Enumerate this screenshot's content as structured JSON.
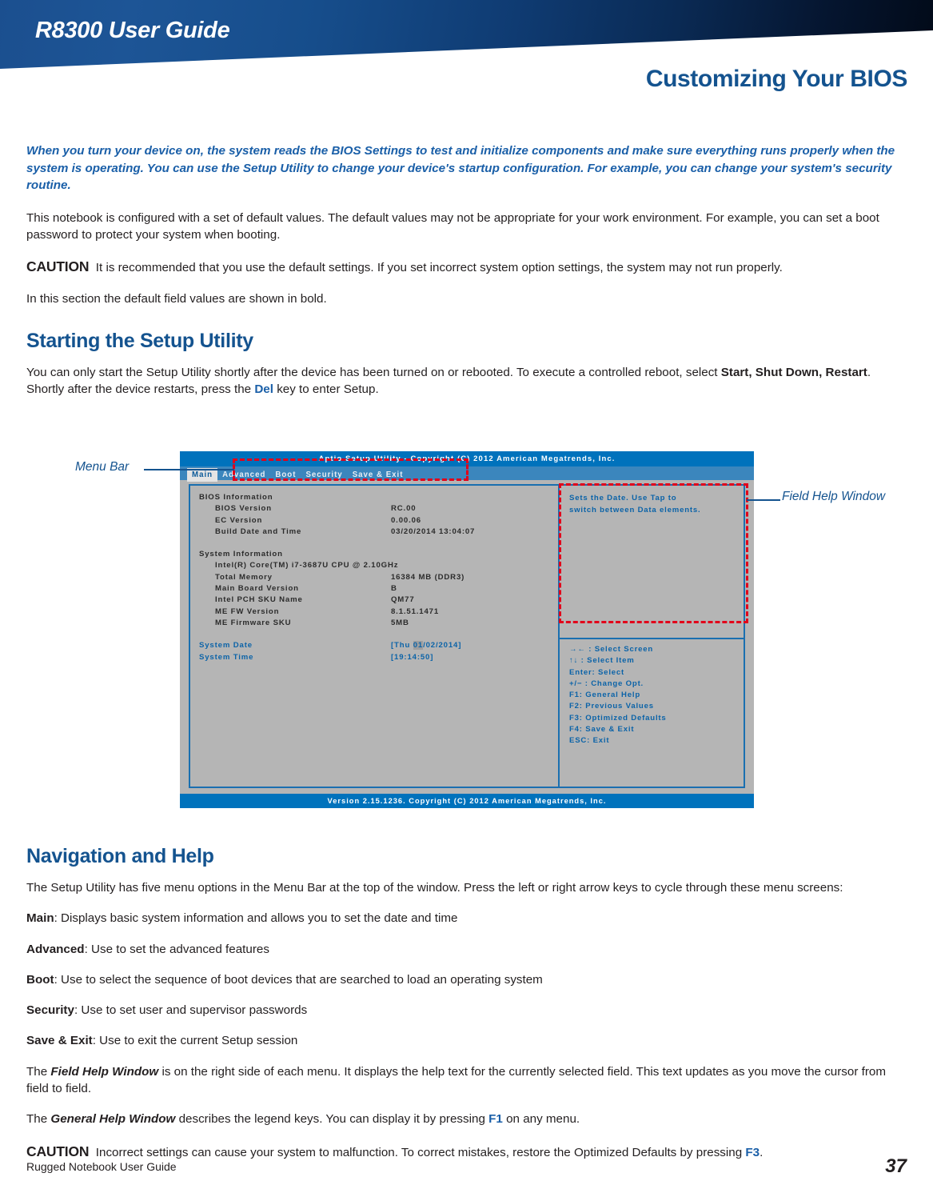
{
  "header": {
    "product_title": "R8300 User Guide",
    "chapter_title": "Customizing Your BIOS"
  },
  "intro": {
    "lead": "When you turn your device on, the system reads the BIOS Settings to test and initialize components and make sure everything runs properly when the system is operating. You can use the Setup Utility to change your device's startup configuration. For example, you can change your system's security routine.",
    "paragraph1": "This notebook is configured with a set of default values. The default values may not be appropriate for your work environment. For example, you can set a boot password to protect your system when booting.",
    "caution_label": "CAUTION",
    "caution1": "It is recommended that you use the default settings. If you set incorrect system option settings, the system may not run properly.",
    "paragraph2": "In this section the default field values are shown in bold."
  },
  "starting": {
    "heading": "Starting the Setup Utility",
    "body_part1": "You can only start the Setup Utility shortly after the device has been turned on or rebooted. To execute a controlled reboot, select ",
    "body_bold": "Start, Shut Down, Restart",
    "body_part2": ". Shortly after the device restarts, press the ",
    "body_key": "Del",
    "body_part3": " key to enter Setup."
  },
  "figure": {
    "callout_menu_bar": "Menu Bar",
    "callout_field_help": "Field Help Window",
    "bios": {
      "titlebar": "Aptio Setup Utility - Copyright (C) 2012 American Megatrends, Inc.",
      "menu_items": [
        {
          "label": "Main",
          "active": true
        },
        {
          "label": "Advanced",
          "active": false
        },
        {
          "label": "Boot",
          "active": false
        },
        {
          "label": "Security",
          "active": false
        },
        {
          "label": "Save & Exit",
          "active": false
        }
      ],
      "bios_info_heading": "BIOS Information",
      "bios_info_rows": [
        {
          "label": "BIOS Version",
          "value": "RC.00"
        },
        {
          "label": "EC Version",
          "value": "0.00.06"
        },
        {
          "label": "Build Date and Time",
          "value": "03/20/2014 13:04:07"
        }
      ],
      "system_info_heading": "System Information",
      "cpu_line": "Intel(R) Core(TM) i7-3687U CPU @ 2.10GHz",
      "system_info_rows": [
        {
          "label": "Total Memory",
          "value": "16384 MB (DDR3)"
        },
        {
          "label": "Main Board  Version",
          "value": "B"
        },
        {
          "label": "Intel PCH SKU Name",
          "value": "QM77"
        },
        {
          "label": "ME FW Version",
          "value": "8.1.51.1471"
        },
        {
          "label": "ME Firmware SKU",
          "value": "5MB"
        }
      ],
      "system_date_label": "System Date",
      "system_date_prefix": "[Thu ",
      "system_date_cursor": "01",
      "system_date_suffix": "/02/2014]",
      "system_time_label": "System Time",
      "system_time_value": "[19:14:50]",
      "field_help_line1": "Sets the Date. Use Tap to",
      "field_help_line2": "switch between Data elements.",
      "legend": [
        "→← : Select Screen",
        "↑↓ : Select Item",
        "Enter: Select",
        "+/− : Change Opt.",
        "F1: General Help",
        "F2: Previous Values",
        "F3: Optimized Defaults",
        "F4: Save & Exit",
        "ESC: Exit"
      ],
      "footer": "Version 2.15.1236. Copyright (C) 2012 American Megatrends, Inc."
    }
  },
  "navigation": {
    "heading": "Navigation and Help",
    "intro": "The Setup Utility has five menu options in the Menu Bar at the top of the window. Press the left or right arrow keys to cycle through these menu screens:",
    "items": [
      {
        "term": "Main",
        "desc": ": Displays basic system information and allows you to set the date and time"
      },
      {
        "term": "Advanced",
        "desc": ": Use to set the advanced features"
      },
      {
        "term": "Boot",
        "desc": ": Use to select the sequence of boot devices that are searched to load an operating system"
      },
      {
        "term": "Security",
        "desc": ": Use to set user and supervisor passwords"
      },
      {
        "term": "Save & Exit",
        "desc": ": Use to exit the current Setup session"
      }
    ],
    "field_help_pre": "The ",
    "field_help_term": "Field Help Window",
    "field_help_post": " is on the right side of each menu. It displays the help text for the currently selected field. This text updates as you move the cursor from field to field.",
    "general_help_pre": "The ",
    "general_help_term": "General Help Window",
    "general_help_mid": " describes the legend keys. You can display it by pressing ",
    "general_help_key": "F1",
    "general_help_post": " on any menu.",
    "caution_label": "CAUTION",
    "caution_pre": "Incorrect settings can cause your system to malfunction. To correct mistakes, restore the Optimized Defaults by pressing ",
    "caution_key": "F3",
    "caution_post": "."
  },
  "footer": {
    "left": "Rugged Notebook User Guide",
    "page_number": "37"
  },
  "colors": {
    "brand_blue": "#14538f",
    "accent_blue": "#1a5fa8",
    "bios_title_blue": "#0072bc",
    "bios_menu_blue": "#3b86bd",
    "bios_gray": "#b5b5b5",
    "annotation_red": "#e2001a"
  }
}
